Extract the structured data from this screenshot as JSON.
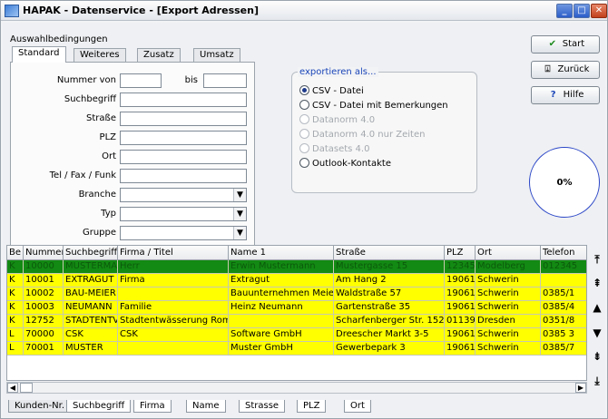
{
  "window": {
    "title": "HAPAK - Datenservice - [Export Adressen]"
  },
  "filter": {
    "group_label": "Auswahlbedingungen",
    "tabs": [
      "Standard",
      "Weiteres",
      "Zusatz",
      "Umsatz"
    ],
    "fields": {
      "nummer_von": "Nummer von",
      "bis": "bis",
      "suchbegriff": "Suchbegriff",
      "strasse": "Straße",
      "plz": "PLZ",
      "ort": "Ort",
      "tel": "Tel / Fax / Funk",
      "branche": "Branche",
      "typ": "Typ",
      "gruppe": "Gruppe"
    }
  },
  "export": {
    "title": "exportieren als...",
    "options": [
      {
        "label": "CSV - Datei",
        "selected": true,
        "enabled": true
      },
      {
        "label": "CSV - Datei mit Bemerkungen",
        "selected": false,
        "enabled": true
      },
      {
        "label": "Datanorm 4.0",
        "selected": false,
        "enabled": false
      },
      {
        "label": "Datanorm 4.0 nur Zeiten",
        "selected": false,
        "enabled": false
      },
      {
        "label": "Datasets 4.0",
        "selected": false,
        "enabled": false
      },
      {
        "label": "Outlook-Kontakte",
        "selected": false,
        "enabled": true
      }
    ]
  },
  "buttons": {
    "start": "Start",
    "zurueck": "Zurück",
    "hilfe": "Hilfe"
  },
  "progress": {
    "label": "0%",
    "value": 0
  },
  "table": {
    "headers": [
      "Be",
      "Nummer",
      "Suchbegriff",
      "Firma / Titel",
      "Name 1",
      "Straße",
      "PLZ",
      "Ort",
      "Telefon"
    ],
    "rows": [
      [
        "K",
        "10000",
        "MUSTERMA",
        "Herr",
        "Erwin Mustermann",
        "Mustergasse 15",
        "12345",
        "Modelberg",
        "012345"
      ],
      [
        "K",
        "10001",
        "EXTRAGUT",
        "Firma",
        "Extragut",
        "Am Hang 2",
        "19061",
        "Schwerin",
        ""
      ],
      [
        "K",
        "10002",
        "BAU-MEIER",
        "",
        "Bauunternehmen Meier G",
        "Waldstraße 57",
        "19061",
        "Schwerin",
        "0385/1"
      ],
      [
        "K",
        "10003",
        "NEUMANN",
        "Familie",
        "Heinz Neumann",
        "Gartenstraße 35",
        "19061",
        "Schwerin",
        "0385/4"
      ],
      [
        "K",
        "12752",
        "STADTENTV",
        "Stadtentwässerung Rom (",
        "",
        "Scharfenberger Str. 152",
        "01139",
        "Dresden",
        "0351/8"
      ],
      [
        "L",
        "70000",
        "CSK",
        "CSK",
        "Software GmbH",
        "Dreescher Markt 3-5",
        "19061",
        "Schwerin",
        "0385 3"
      ],
      [
        "L",
        "70001",
        "MUSTER",
        "",
        "Muster GmbH",
        "Gewerbepark 3",
        "19061",
        "Schwerin",
        "0385/7"
      ]
    ]
  },
  "bottom_tabs": [
    "Kunden-Nr.",
    "Suchbegriff",
    "Firma",
    "Name",
    "Strasse",
    "PLZ",
    "Ort"
  ],
  "colors": {
    "selected_row": "#138a13",
    "row": "#ffff00",
    "accent": "#1a45b8"
  }
}
